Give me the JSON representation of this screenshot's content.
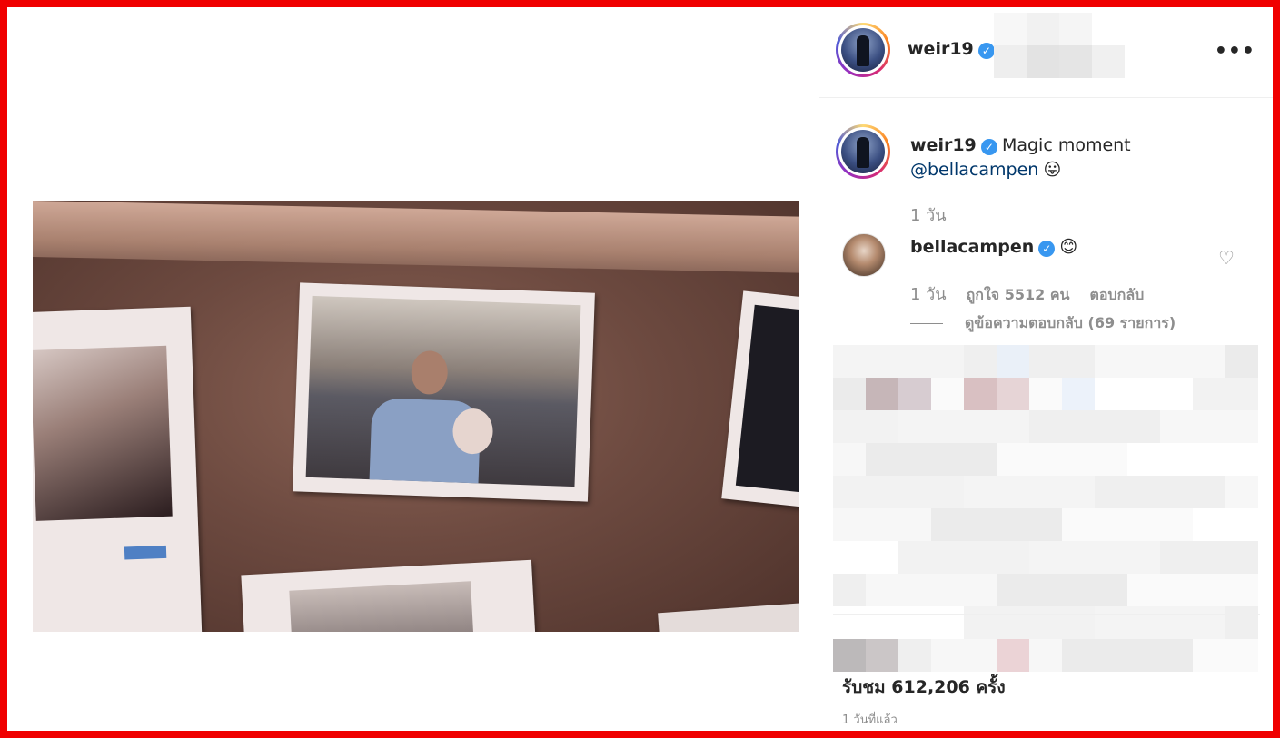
{
  "post": {
    "author": "weir19",
    "author_avatar_icon": "profile-avatar-icon",
    "verified_icon": "verified-badge-icon",
    "more_icon": "more-options-icon",
    "more_label": "•••"
  },
  "caption": {
    "username": "weir19",
    "text": "Magic moment",
    "mention": "@bellacampen",
    "emoji": "😛",
    "time": "1 วัน"
  },
  "comment": {
    "username": "bellacampen",
    "emoji": "😊",
    "time": "1 วัน",
    "likes": "ถูกใจ 5512 คน",
    "reply": "ตอบกลับ",
    "view_replies": "ดูข้อความตอบกลับ (69 รายการ)",
    "like_icon": "heart-outline-icon"
  },
  "stats": {
    "views": "รับชม 612,206 ครั้ง",
    "posted_ago": "1 วันที่แล้ว"
  },
  "colors": {
    "border": "#f00000",
    "verified": "#3897f0",
    "mention": "#00376b",
    "muted": "#8e8e8e"
  }
}
